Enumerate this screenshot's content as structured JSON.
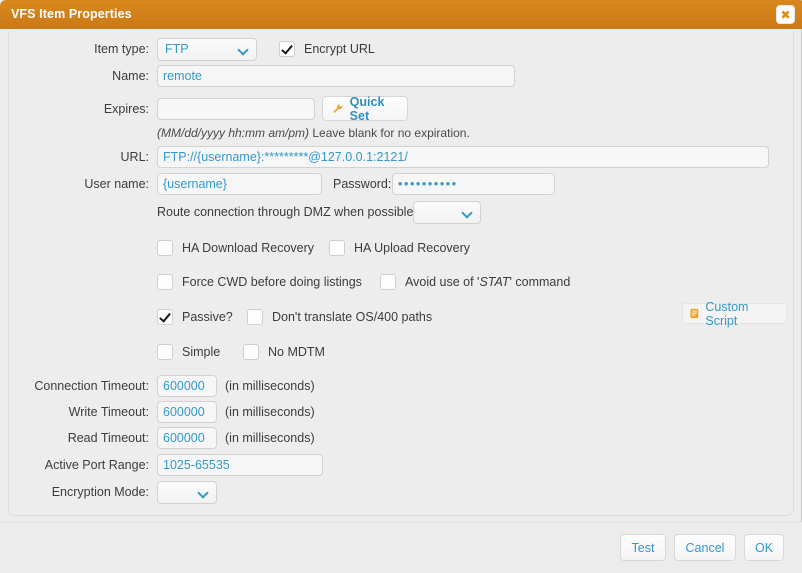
{
  "window": {
    "title": "VFS Item Properties",
    "close_icon": "close-icon",
    "close_glyph": "✖"
  },
  "colors": {
    "titlebar": "#d2801a",
    "accent_blue": "#3399cc",
    "panel_bg": "#ededed",
    "field_bg": "#f6f6f6"
  },
  "form": {
    "item_type": {
      "label": "Item type:",
      "value": "FTP",
      "options": [
        "FTP"
      ]
    },
    "encrypt_url": {
      "label": "Encrypt URL",
      "checked": true
    },
    "name": {
      "label": "Name:",
      "value": "remote",
      "placeholder": ""
    },
    "expires": {
      "label": "Expires:",
      "value": "",
      "placeholder": ""
    },
    "quick_set": {
      "label": "Quick Set",
      "icon": "wrench-icon"
    },
    "expires_hint": {
      "format": "(MM/dd/yyyy hh:mm am/pm)",
      "text": " Leave blank for no expiration."
    },
    "url": {
      "label": "URL:",
      "value": "FTP://{username}:*********@127.0.0.1:2121/"
    },
    "user_name": {
      "label": "User name:",
      "value": "{username}"
    },
    "password": {
      "label": "Password:",
      "value": "••••••••••"
    },
    "dmz": {
      "label": "Route connection through DMZ when possible:",
      "value": "",
      "options": [
        ""
      ]
    },
    "checkboxes": [
      {
        "name": "ha-download-recovery",
        "label": "HA Download Recovery",
        "checked": false
      },
      {
        "name": "ha-upload-recovery",
        "label": "HA Upload Recovery",
        "checked": false
      },
      {
        "name": "force-cwd",
        "label": "Force CWD before doing listings",
        "checked": false
      },
      {
        "name": "avoid-stat",
        "label": "Avoid use of 'STAT' command",
        "checked": false,
        "italic_part": "STAT"
      },
      {
        "name": "passive",
        "label": "Passive?",
        "checked": true
      },
      {
        "name": "no-translate-os400",
        "label": "Don't translate OS/400 paths",
        "checked": false
      },
      {
        "name": "simple",
        "label": "Simple",
        "checked": false
      },
      {
        "name": "no-mdtm",
        "label": "No MDTM",
        "checked": false
      }
    ],
    "custom_script": {
      "label": "Custom Script",
      "icon": "script-icon"
    },
    "connection_timeout": {
      "label": "Connection Timeout:",
      "value": "600000",
      "units": "(in milliseconds)"
    },
    "write_timeout": {
      "label": "Write Timeout:",
      "value": "600000",
      "units": "(in milliseconds)"
    },
    "read_timeout": {
      "label": "Read Timeout:",
      "value": "600000",
      "units": "(in milliseconds)"
    },
    "active_port_range": {
      "label": "Active Port Range:",
      "value": "1025-65535"
    },
    "encryption_mode": {
      "label": "Encryption Mode:",
      "value": "",
      "options": [
        ""
      ]
    }
  },
  "footer": {
    "test": "Test",
    "cancel": "Cancel",
    "ok": "OK"
  }
}
